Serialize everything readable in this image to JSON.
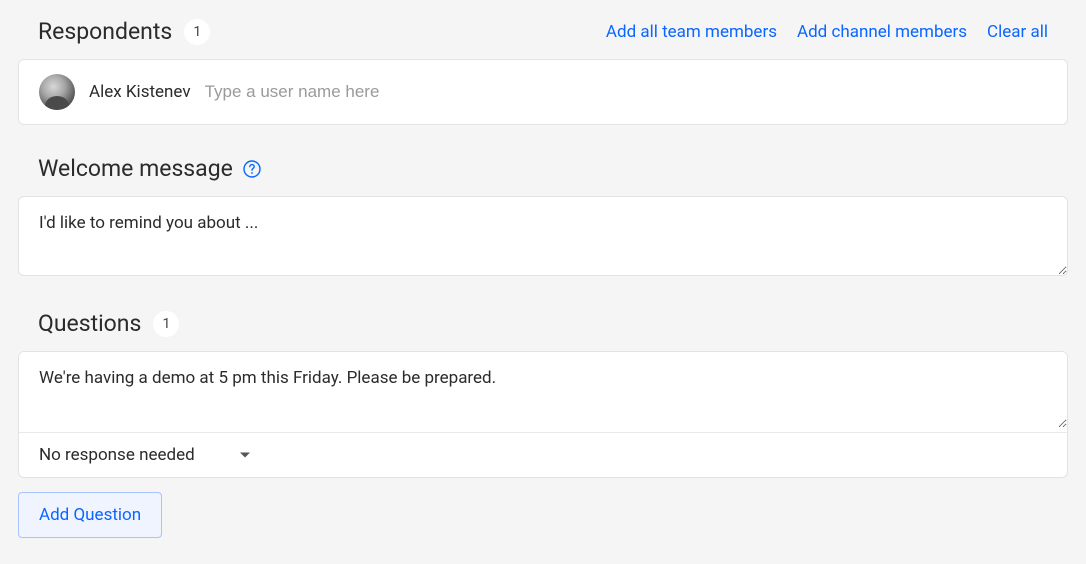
{
  "respondents": {
    "title": "Respondents",
    "count": "1",
    "actions": {
      "add_team": "Add all team members",
      "add_channel": "Add channel members",
      "clear": "Clear all"
    },
    "user_chip_name": "Alex Kistenev",
    "input_placeholder": "Type a user name here"
  },
  "welcome": {
    "title": "Welcome message",
    "value": "I'd like to remind you about ..."
  },
  "questions": {
    "title": "Questions",
    "count": "1",
    "items": [
      {
        "text": "We're having a demo at 5 pm this Friday. Please be prepared.",
        "response_type": "No response needed"
      }
    ],
    "add_label": "Add Question"
  }
}
